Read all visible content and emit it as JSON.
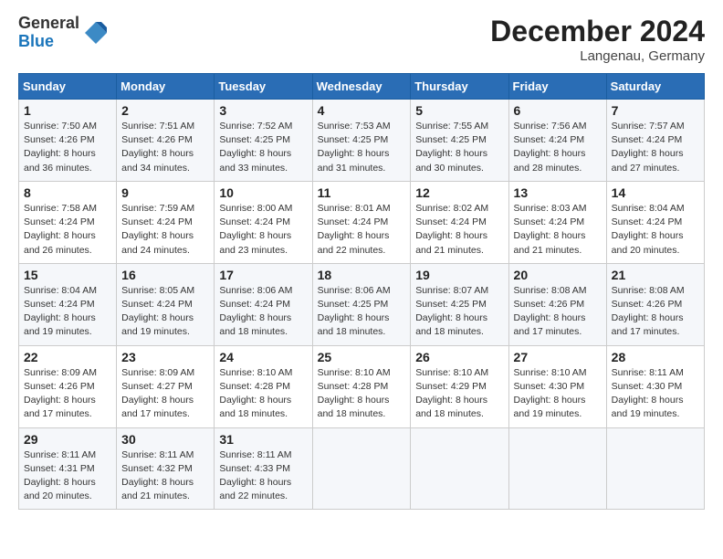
{
  "header": {
    "logo_general": "General",
    "logo_blue": "Blue",
    "title": "December 2024",
    "location": "Langenau, Germany"
  },
  "calendar": {
    "days_of_week": [
      "Sunday",
      "Monday",
      "Tuesday",
      "Wednesday",
      "Thursday",
      "Friday",
      "Saturday"
    ],
    "weeks": [
      [
        {
          "day": "1",
          "sunrise": "Sunrise: 7:50 AM",
          "sunset": "Sunset: 4:26 PM",
          "daylight": "Daylight: 8 hours and 36 minutes."
        },
        {
          "day": "2",
          "sunrise": "Sunrise: 7:51 AM",
          "sunset": "Sunset: 4:26 PM",
          "daylight": "Daylight: 8 hours and 34 minutes."
        },
        {
          "day": "3",
          "sunrise": "Sunrise: 7:52 AM",
          "sunset": "Sunset: 4:25 PM",
          "daylight": "Daylight: 8 hours and 33 minutes."
        },
        {
          "day": "4",
          "sunrise": "Sunrise: 7:53 AM",
          "sunset": "Sunset: 4:25 PM",
          "daylight": "Daylight: 8 hours and 31 minutes."
        },
        {
          "day": "5",
          "sunrise": "Sunrise: 7:55 AM",
          "sunset": "Sunset: 4:25 PM",
          "daylight": "Daylight: 8 hours and 30 minutes."
        },
        {
          "day": "6",
          "sunrise": "Sunrise: 7:56 AM",
          "sunset": "Sunset: 4:24 PM",
          "daylight": "Daylight: 8 hours and 28 minutes."
        },
        {
          "day": "7",
          "sunrise": "Sunrise: 7:57 AM",
          "sunset": "Sunset: 4:24 PM",
          "daylight": "Daylight: 8 hours and 27 minutes."
        }
      ],
      [
        {
          "day": "8",
          "sunrise": "Sunrise: 7:58 AM",
          "sunset": "Sunset: 4:24 PM",
          "daylight": "Daylight: 8 hours and 26 minutes."
        },
        {
          "day": "9",
          "sunrise": "Sunrise: 7:59 AM",
          "sunset": "Sunset: 4:24 PM",
          "daylight": "Daylight: 8 hours and 24 minutes."
        },
        {
          "day": "10",
          "sunrise": "Sunrise: 8:00 AM",
          "sunset": "Sunset: 4:24 PM",
          "daylight": "Daylight: 8 hours and 23 minutes."
        },
        {
          "day": "11",
          "sunrise": "Sunrise: 8:01 AM",
          "sunset": "Sunset: 4:24 PM",
          "daylight": "Daylight: 8 hours and 22 minutes."
        },
        {
          "day": "12",
          "sunrise": "Sunrise: 8:02 AM",
          "sunset": "Sunset: 4:24 PM",
          "daylight": "Daylight: 8 hours and 21 minutes."
        },
        {
          "day": "13",
          "sunrise": "Sunrise: 8:03 AM",
          "sunset": "Sunset: 4:24 PM",
          "daylight": "Daylight: 8 hours and 21 minutes."
        },
        {
          "day": "14",
          "sunrise": "Sunrise: 8:04 AM",
          "sunset": "Sunset: 4:24 PM",
          "daylight": "Daylight: 8 hours and 20 minutes."
        }
      ],
      [
        {
          "day": "15",
          "sunrise": "Sunrise: 8:04 AM",
          "sunset": "Sunset: 4:24 PM",
          "daylight": "Daylight: 8 hours and 19 minutes."
        },
        {
          "day": "16",
          "sunrise": "Sunrise: 8:05 AM",
          "sunset": "Sunset: 4:24 PM",
          "daylight": "Daylight: 8 hours and 19 minutes."
        },
        {
          "day": "17",
          "sunrise": "Sunrise: 8:06 AM",
          "sunset": "Sunset: 4:24 PM",
          "daylight": "Daylight: 8 hours and 18 minutes."
        },
        {
          "day": "18",
          "sunrise": "Sunrise: 8:06 AM",
          "sunset": "Sunset: 4:25 PM",
          "daylight": "Daylight: 8 hours and 18 minutes."
        },
        {
          "day": "19",
          "sunrise": "Sunrise: 8:07 AM",
          "sunset": "Sunset: 4:25 PM",
          "daylight": "Daylight: 8 hours and 18 minutes."
        },
        {
          "day": "20",
          "sunrise": "Sunrise: 8:08 AM",
          "sunset": "Sunset: 4:26 PM",
          "daylight": "Daylight: 8 hours and 17 minutes."
        },
        {
          "day": "21",
          "sunrise": "Sunrise: 8:08 AM",
          "sunset": "Sunset: 4:26 PM",
          "daylight": "Daylight: 8 hours and 17 minutes."
        }
      ],
      [
        {
          "day": "22",
          "sunrise": "Sunrise: 8:09 AM",
          "sunset": "Sunset: 4:26 PM",
          "daylight": "Daylight: 8 hours and 17 minutes."
        },
        {
          "day": "23",
          "sunrise": "Sunrise: 8:09 AM",
          "sunset": "Sunset: 4:27 PM",
          "daylight": "Daylight: 8 hours and 17 minutes."
        },
        {
          "day": "24",
          "sunrise": "Sunrise: 8:10 AM",
          "sunset": "Sunset: 4:28 PM",
          "daylight": "Daylight: 8 hours and 18 minutes."
        },
        {
          "day": "25",
          "sunrise": "Sunrise: 8:10 AM",
          "sunset": "Sunset: 4:28 PM",
          "daylight": "Daylight: 8 hours and 18 minutes."
        },
        {
          "day": "26",
          "sunrise": "Sunrise: 8:10 AM",
          "sunset": "Sunset: 4:29 PM",
          "daylight": "Daylight: 8 hours and 18 minutes."
        },
        {
          "day": "27",
          "sunrise": "Sunrise: 8:10 AM",
          "sunset": "Sunset: 4:30 PM",
          "daylight": "Daylight: 8 hours and 19 minutes."
        },
        {
          "day": "28",
          "sunrise": "Sunrise: 8:11 AM",
          "sunset": "Sunset: 4:30 PM",
          "daylight": "Daylight: 8 hours and 19 minutes."
        }
      ],
      [
        {
          "day": "29",
          "sunrise": "Sunrise: 8:11 AM",
          "sunset": "Sunset: 4:31 PM",
          "daylight": "Daylight: 8 hours and 20 minutes."
        },
        {
          "day": "30",
          "sunrise": "Sunrise: 8:11 AM",
          "sunset": "Sunset: 4:32 PM",
          "daylight": "Daylight: 8 hours and 21 minutes."
        },
        {
          "day": "31",
          "sunrise": "Sunrise: 8:11 AM",
          "sunset": "Sunset: 4:33 PM",
          "daylight": "Daylight: 8 hours and 22 minutes."
        },
        null,
        null,
        null,
        null
      ]
    ]
  }
}
